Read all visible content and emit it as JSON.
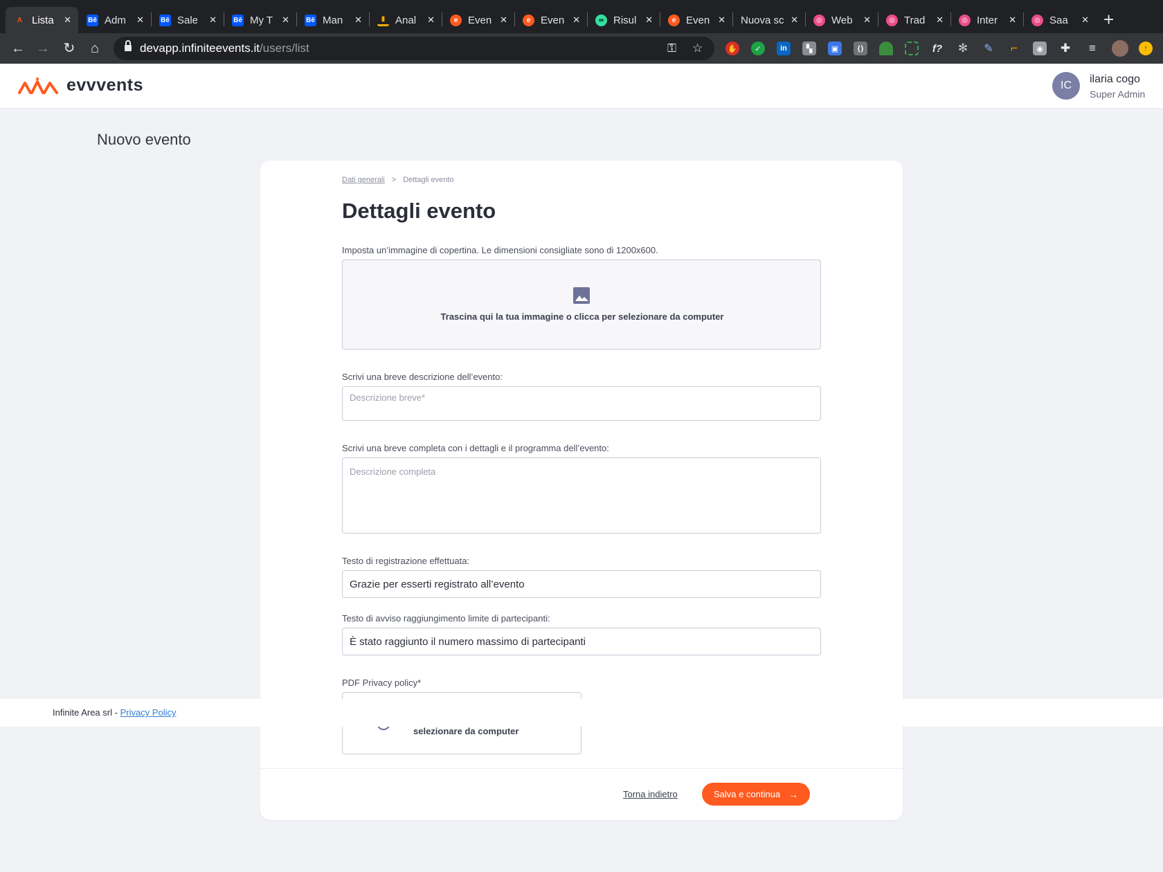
{
  "browser": {
    "tabs": [
      {
        "title": "Lista",
        "icon": "infinite-events-icon",
        "color": "#ff5a1f",
        "active": true
      },
      {
        "title": "Adm",
        "icon": "behance-icon",
        "color": "#0057ff"
      },
      {
        "title": "Sale",
        "icon": "behance-icon",
        "color": "#0057ff"
      },
      {
        "title": "My T",
        "icon": "behance-icon",
        "color": "#0057ff"
      },
      {
        "title": "Man",
        "icon": "behance-icon",
        "color": "#0057ff"
      },
      {
        "title": "Anal",
        "icon": "analytics-icon",
        "color": "#f9ab00"
      },
      {
        "title": "Even",
        "icon": "evvvents-icon",
        "color": "#ff5a1f"
      },
      {
        "title": "Even",
        "icon": "evvvents-icon",
        "color": "#ff5a1f"
      },
      {
        "title": "Risul",
        "icon": "tripadvisor-icon",
        "color": "#34e0a1"
      },
      {
        "title": "Even",
        "icon": "evvvents-icon",
        "color": "#ff5a1f"
      },
      {
        "title": "Nuova sc",
        "icon": "",
        "color": ""
      },
      {
        "title": "Web",
        "icon": "dribbble-icon",
        "color": "#ea4c89"
      },
      {
        "title": "Trad",
        "icon": "dribbble-icon",
        "color": "#ea4c89"
      },
      {
        "title": "Inter",
        "icon": "dribbble-icon",
        "color": "#ea4c89"
      },
      {
        "title": "Saa",
        "icon": "dribbble-icon",
        "color": "#ea4c89"
      }
    ],
    "url_domain": "devapp.infiniteevents.it",
    "url_path": "/users/list"
  },
  "app": {
    "brand": "evvvents",
    "brand_color": "#ff5a1f",
    "user": {
      "initials": "IC",
      "name": "ilaria cogo",
      "role": "Super Admin"
    }
  },
  "page": {
    "heading": "Nuovo evento"
  },
  "breadcrumb": {
    "step1": "Dati generali",
    "separator": ">",
    "step2": "Dettagli evento"
  },
  "form": {
    "title": "Dettagli evento",
    "cover": {
      "label": "Imposta un’immagine di copertina. Le dimensioni consigliate sono di 1200x600.",
      "drop_text": "Trascina qui la tua immagine o clicca per selezionare da computer"
    },
    "short_desc": {
      "label": "Scrivi una breve descrizione dell’evento:",
      "placeholder": "Descrizione breve*",
      "value": ""
    },
    "full_desc": {
      "label": "Scrivi una breve completa con i dettagli e il programma dell’evento:",
      "placeholder": "Descrizione completa",
      "value": ""
    },
    "registration_text": {
      "label": "Testo di registrazione effettuata:",
      "value": "Grazie per esserti registrato all’evento"
    },
    "limit_text": {
      "label": "Testo di avviso raggiungimento limite di partecipanti:",
      "value": "È stato raggiunto il numero massimo di partecipanti"
    },
    "pdf": {
      "label": "PDF Privacy policy*",
      "drop_text": "selezionare da computer"
    }
  },
  "footer": {
    "company": "Infinite Area srl -",
    "privacy_link": "Privacy Policy"
  },
  "actions": {
    "back": "Torna indietro",
    "save": "Salva e continua",
    "save_color": "#ff5a1f"
  }
}
